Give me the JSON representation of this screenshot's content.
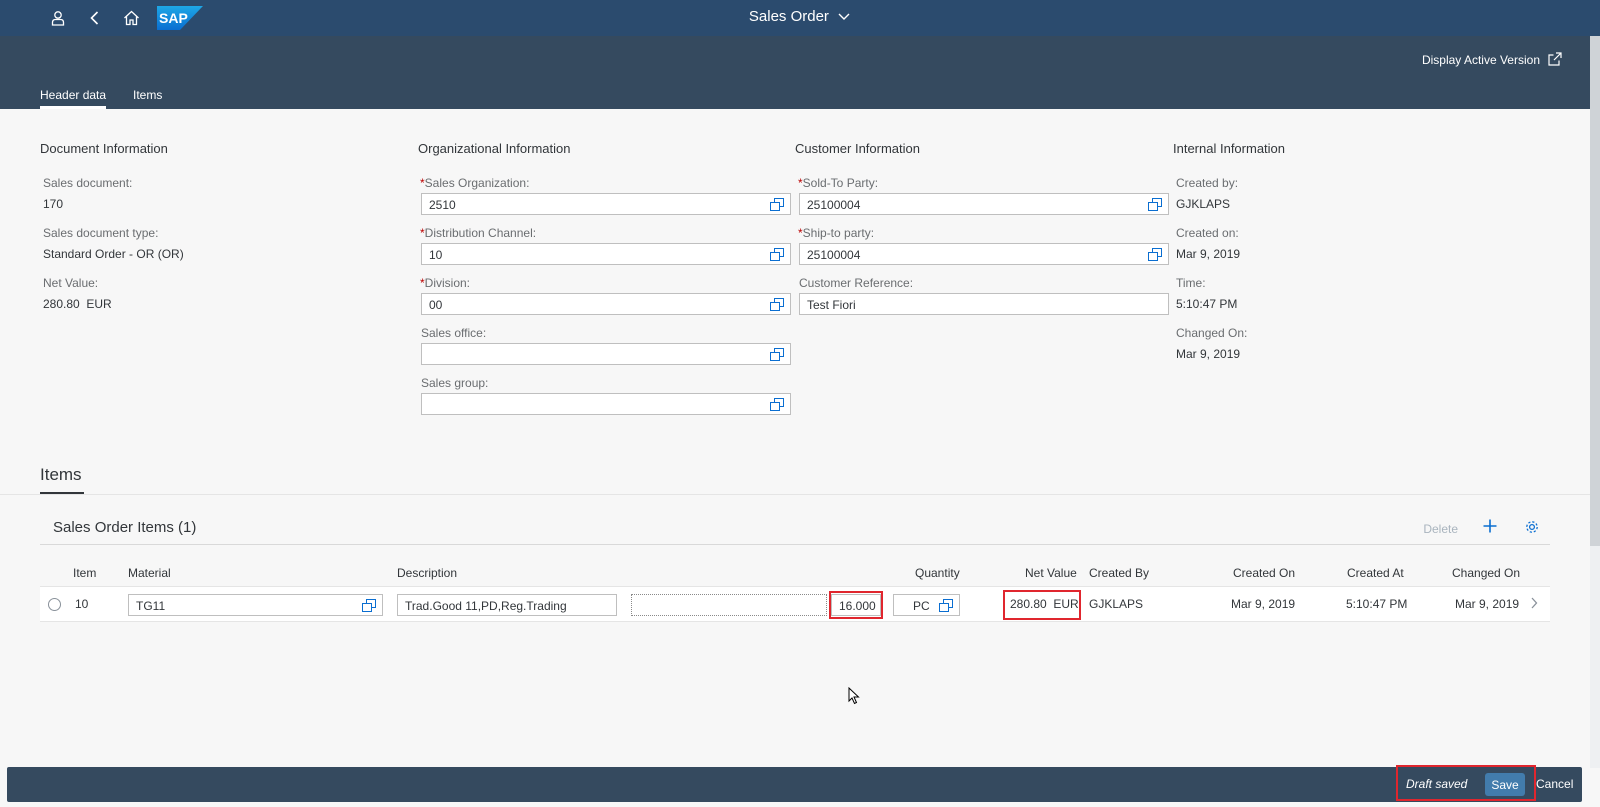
{
  "shell": {
    "logo_text": "SAP",
    "title": "Sales Order"
  },
  "header": {
    "display_active_version": "Display Active Version",
    "tabs": [
      {
        "label": "Header data",
        "active": true
      },
      {
        "label": "Items",
        "active": false
      }
    ]
  },
  "document_info": {
    "title": "Document Information",
    "sales_document_label": "Sales document:",
    "sales_document_value": "170",
    "doc_type_label": "Sales document type:",
    "doc_type_value": "Standard Order - OR (OR)",
    "net_value_label": "Net Value:",
    "net_value_value": "280.80  EUR"
  },
  "org_info": {
    "title": "Organizational Information",
    "sales_org_label": "Sales Organization:",
    "sales_org_value": "2510",
    "dist_channel_label": "Distribution Channel:",
    "dist_channel_value": "10",
    "division_label": "Division:",
    "division_value": "00",
    "sales_office_label": "Sales office:",
    "sales_office_value": "",
    "sales_group_label": "Sales group:",
    "sales_group_value": ""
  },
  "customer_info": {
    "title": "Customer Information",
    "sold_to_label": "Sold-To Party:",
    "sold_to_value": "25100004",
    "ship_to_label": "Ship-to party:",
    "ship_to_value": "25100004",
    "customer_ref_label": "Customer Reference:",
    "customer_ref_value": "Test Fiori"
  },
  "internal_info": {
    "title": "Internal Information",
    "created_by_label": "Created by:",
    "created_by_value": "GJKLAPS",
    "created_on_label": "Created on:",
    "created_on_value": "Mar 9, 2019",
    "time_label": "Time:",
    "time_value": "5:10:47 PM",
    "changed_on_label": "Changed On:",
    "changed_on_value": "Mar 9, 2019"
  },
  "items_section": {
    "heading": "Items",
    "table_title": "Sales Order Items (1)",
    "delete_label": "Delete",
    "columns": {
      "item": "Item",
      "material": "Material",
      "description": "Description",
      "quantity": "Quantity",
      "net_value": "Net Value",
      "created_by": "Created By",
      "created_on": "Created On",
      "created_at": "Created At",
      "changed_on": "Changed On"
    },
    "rows": [
      {
        "item": "10",
        "material": "TG11",
        "description": "Trad.Good 11,PD,Reg.Trading",
        "quantity": "16.000",
        "unit": "PC",
        "net_value": "280.80  EUR",
        "created_by": "GJKLAPS",
        "created_on": "Mar 9, 2019",
        "created_at": "5:10:47 PM",
        "changed_on": "Mar 9, 2019"
      }
    ]
  },
  "footer": {
    "draft_status": "Draft saved",
    "save_label": "Save",
    "cancel_label": "Cancel"
  },
  "colors": {
    "shell_bg": "#2b4b6e",
    "header_bg": "#354a5f",
    "required": "#bb0000",
    "highlight_box": "#e0262e",
    "save_button": "#427cac"
  }
}
